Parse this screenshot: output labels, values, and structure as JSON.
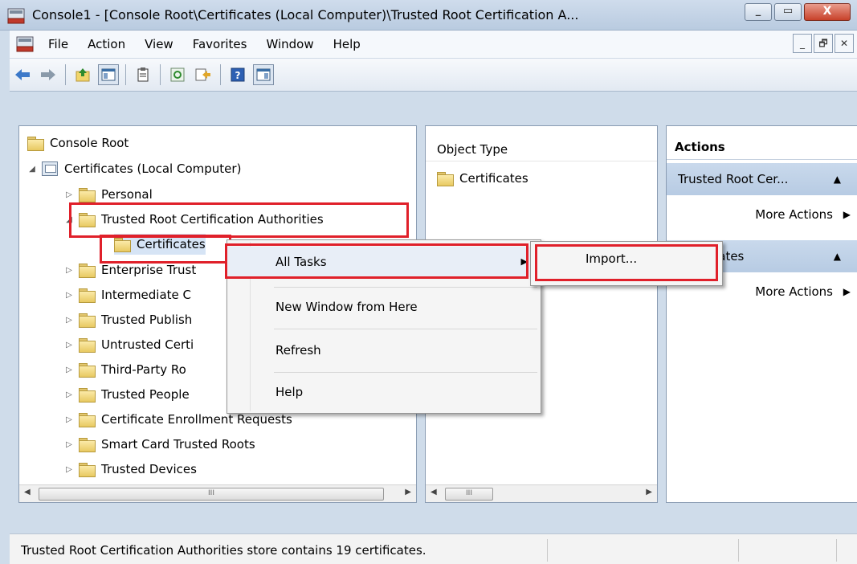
{
  "window": {
    "title": "Console1 - [Console Root\\Certificates (Local Computer)\\Trusted Root Certification A...",
    "minimize": "_",
    "restore": "▭",
    "close": "X"
  },
  "menu": {
    "items": [
      "File",
      "Action",
      "View",
      "Favorites",
      "Window",
      "Help"
    ],
    "mdi": [
      "_",
      "🗗",
      "✕"
    ]
  },
  "tree": {
    "root": "Console Root",
    "computer": "Certificates (Local Computer)",
    "items": [
      "Personal",
      "Trusted Root Certification Authorities",
      "Certificates",
      "Enterprise Trust",
      "Intermediate C",
      "Trusted Publish",
      "Untrusted Certi",
      "Third-Party Ro",
      "Trusted People",
      "Certificate Enrollment Requests",
      "Smart Card Trusted Roots",
      "Trusted Devices"
    ]
  },
  "middle": {
    "header": "Object Type",
    "row": "Certificates"
  },
  "actions": {
    "header": "Actions",
    "section1": "Trusted Root Cer...",
    "more1": "More Actions",
    "section2": "cates",
    "more2": "More Actions"
  },
  "context_menu": {
    "items": [
      "All Tasks",
      "New Window from Here",
      "Refresh",
      "Help"
    ],
    "submenu": "Import..."
  },
  "status": {
    "text": "Trusted Root Certification Authorities store contains 19 certificates."
  },
  "scrollbar": {
    "grip": "III"
  },
  "colors": {
    "highlight": "#e0202a",
    "actions_section": "#c9d9ec"
  }
}
